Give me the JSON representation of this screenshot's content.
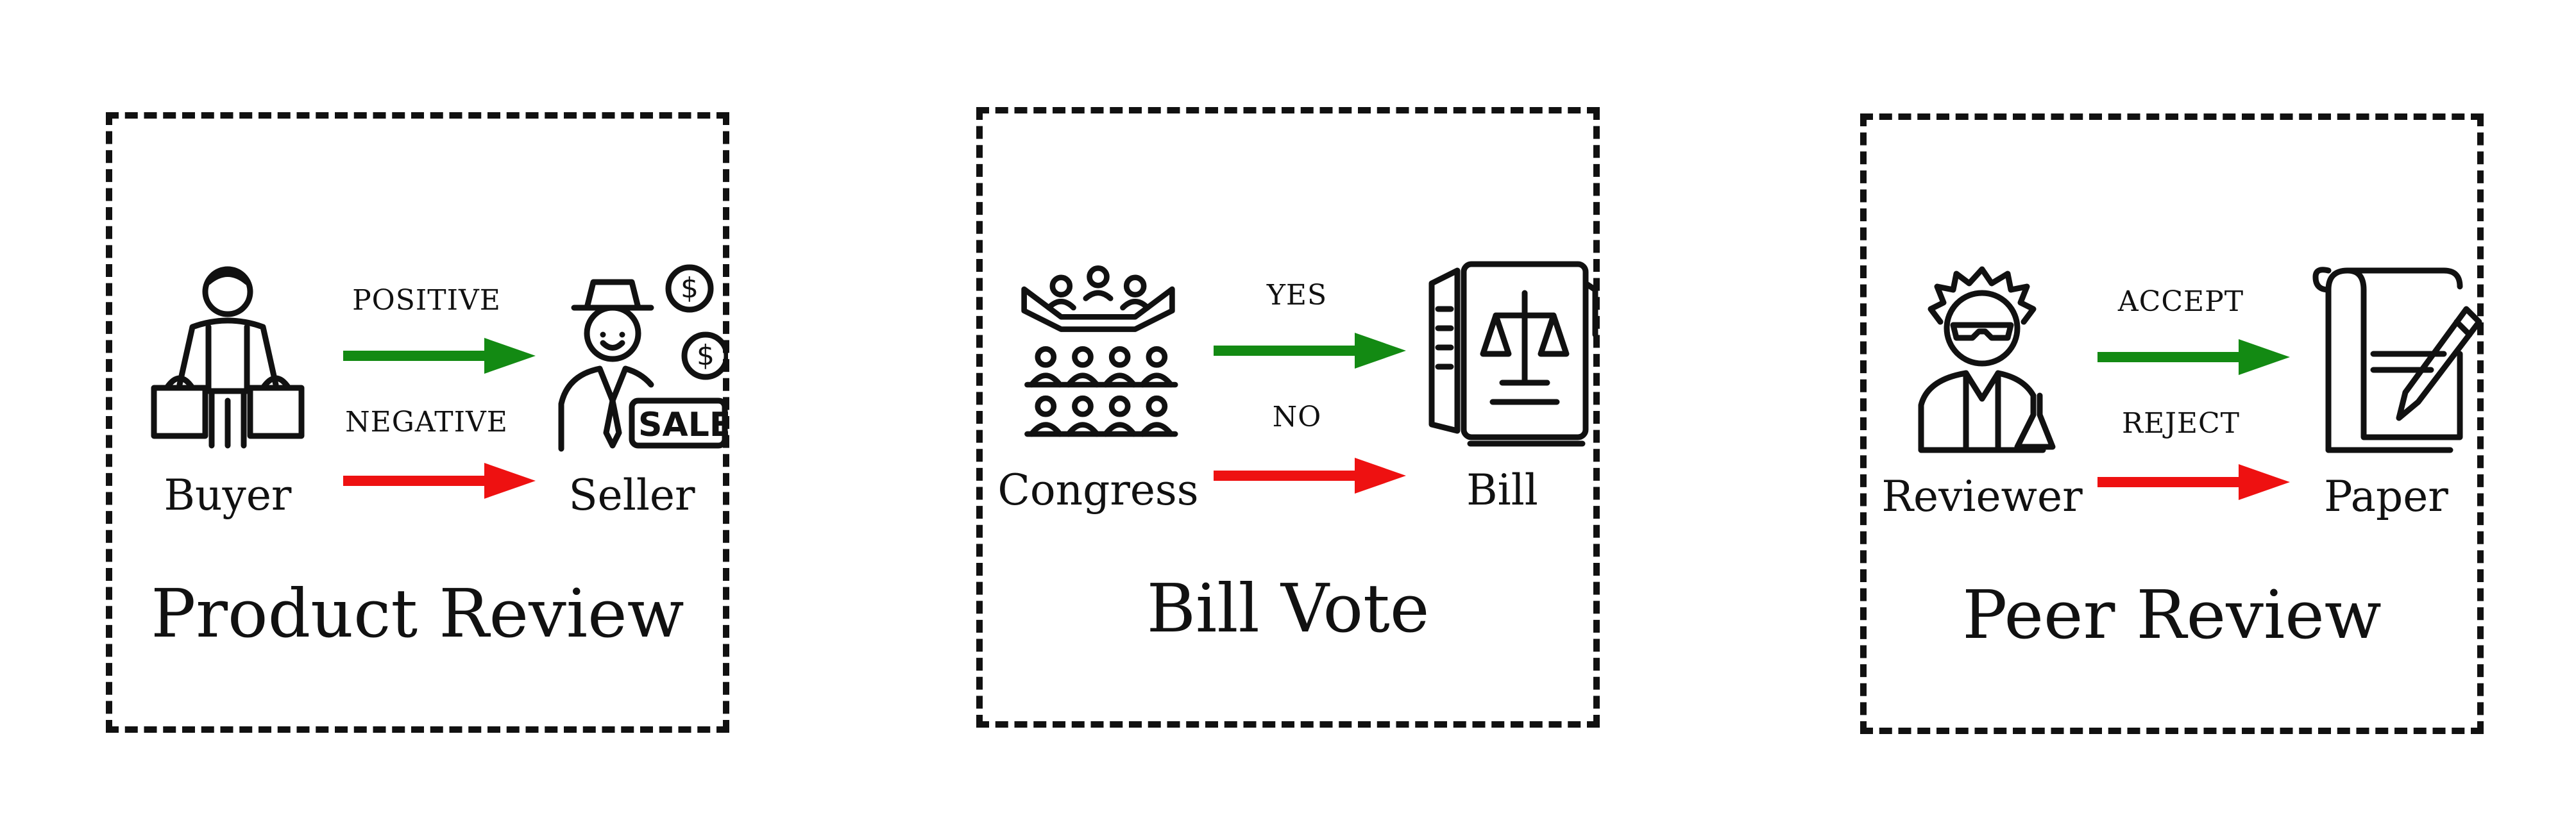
{
  "colors": {
    "positive": "#138a13",
    "negative": "#ee1111",
    "ink": "#111111"
  },
  "panels": [
    {
      "title": "Product Review",
      "actor": "Buyer",
      "target": "Seller",
      "positive": "POSITIVE",
      "negative": "NEGATIVE",
      "actor_icon": "shopper-with-bags-icon",
      "target_icon": "salesman-with-sale-sign-icon"
    },
    {
      "title": "Bill Vote",
      "actor": "Congress",
      "target": "Bill",
      "positive": "YES",
      "negative": "NO",
      "actor_icon": "congress-assembly-icon",
      "target_icon": "law-document-icon"
    },
    {
      "title": "Peer Review",
      "actor": "Reviewer",
      "target": "Paper",
      "positive": "ACCEPT",
      "negative": "REJECT",
      "actor_icon": "scientist-icon",
      "target_icon": "paper-with-pen-icon"
    }
  ]
}
